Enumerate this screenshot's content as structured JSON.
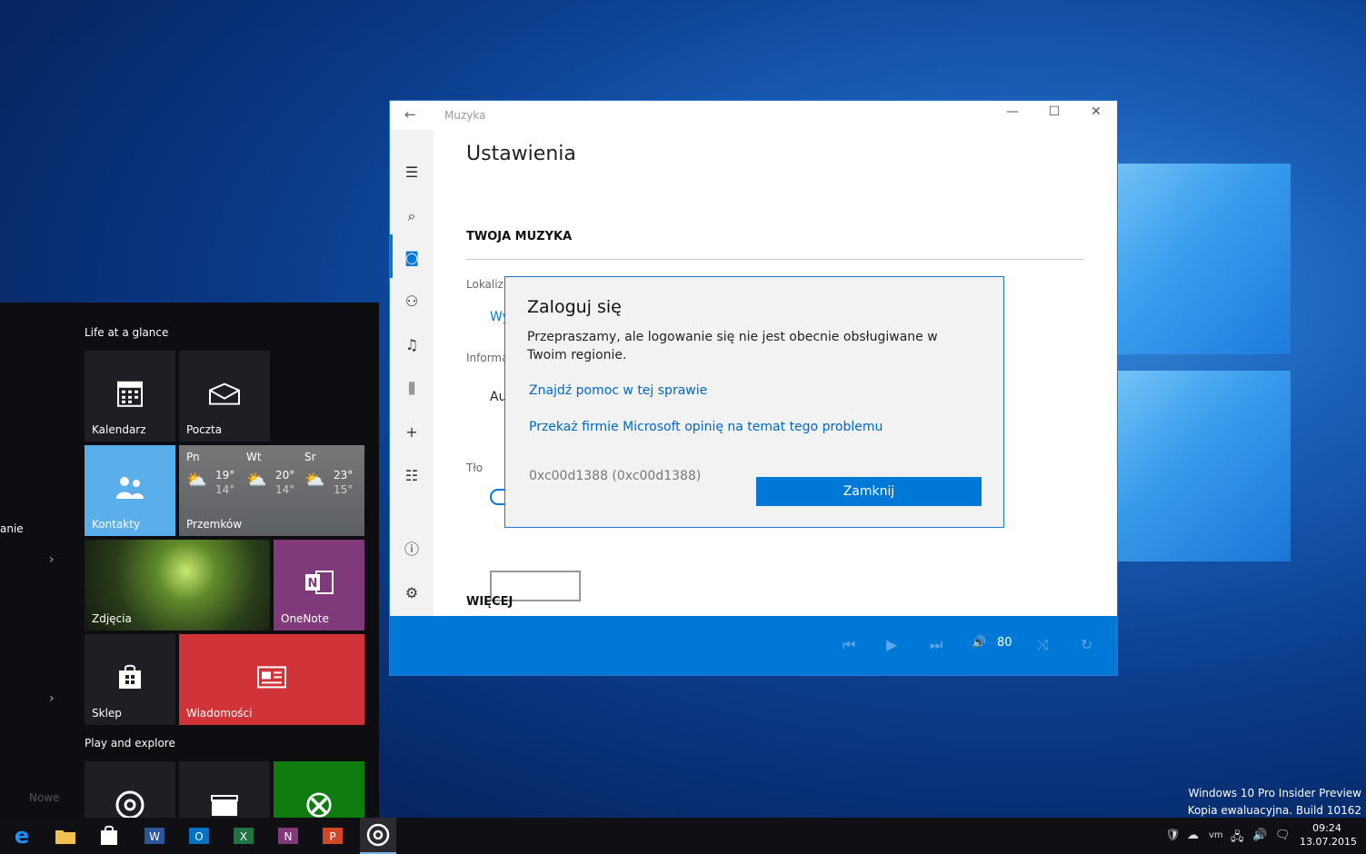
{
  "start_menu": {
    "left_label": "anie",
    "nowe_label": "Nowe",
    "group1_title": "Life at a glance",
    "group2_title": "Play and explore",
    "tiles": {
      "calendar": "Kalendarz",
      "mail": "Poczta",
      "contacts": "Kontakty",
      "weather_city": "Przemków",
      "photos": "Zdjęcia",
      "onenote": "OneNote",
      "store": "Sklep",
      "news": "Wiadomości"
    },
    "weather": [
      {
        "day": "Pn",
        "high": "19°",
        "low": "14°"
      },
      {
        "day": "Wt",
        "high": "20°",
        "low": "14°"
      },
      {
        "day": "Sr",
        "high": "23°",
        "low": "15°"
      }
    ]
  },
  "app": {
    "title": "Muzyka",
    "page_title": "Ustawienia",
    "section_music": "TWOJA MUZYKA",
    "section_more": "WIĘCEJ",
    "label_location": "Lokaliza",
    "link_partial": "Wy",
    "label_info": "Informa",
    "auto_partial": "Au",
    "label_background": "Tło",
    "volume": "80"
  },
  "dialog": {
    "title": "Zaloguj się",
    "message": "Przepraszamy, ale logowanie się nie jest obecnie obsługiwane w Twoim regionie.",
    "help_link": "Znajdź pomoc w tej sprawie",
    "feedback_link": "Przekaż firmie Microsoft opinię na temat tego problemu",
    "error_code": "0xc00d1388 (0xc00d1388)",
    "close_button": "Zamknij"
  },
  "watermark": {
    "line1": "Windows 10 Pro Insider Preview",
    "line2": "Kopia ewaluacyjna. Build 10162"
  },
  "clock": {
    "time": "09:24",
    "date": "13.07.2015"
  },
  "colors": {
    "accent": "#0078d7",
    "tile_contacts": "#5aaeea",
    "tile_onenote": "#80397b",
    "tile_news": "#d13438",
    "tile_xbox": "#107c10"
  }
}
